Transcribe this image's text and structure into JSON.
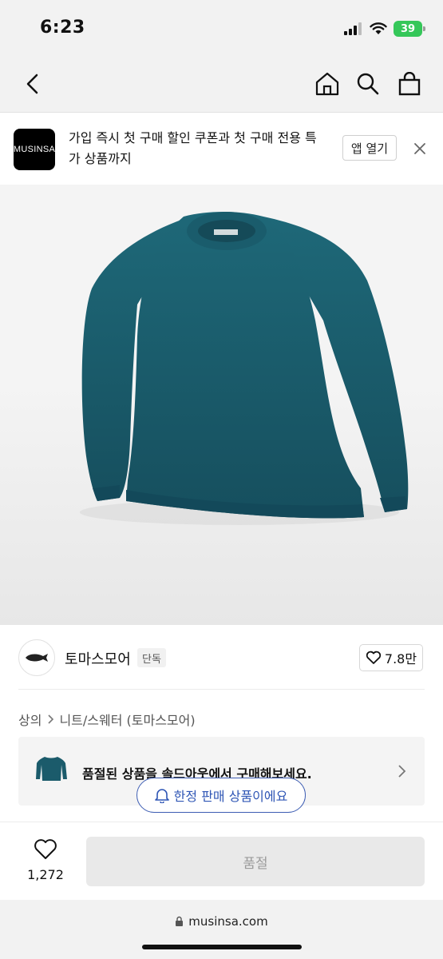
{
  "status": {
    "time": "6:23",
    "battery": "39"
  },
  "nav": {
    "icons": [
      "back-arrow-icon",
      "home-icon",
      "search-icon",
      "shopping-bag-icon"
    ]
  },
  "banner": {
    "logo_text": "MUSINSA",
    "text": "가입 즉시 첫 구매 할인 쿠폰과 첫 구매 전용 특가 상품까지",
    "open_label": "앱 열기"
  },
  "brand": {
    "name": "토마스모어",
    "badge": "단독",
    "likes": "7.8만"
  },
  "breadcrumb": {
    "items": [
      "상의",
      "니트/스웨터 (토마스모어)"
    ]
  },
  "soldout": {
    "message": "품절된 상품을 솔드아웃에서 구매해보세요."
  },
  "limited": {
    "label": "한정 판매 상품이에요"
  },
  "bottom": {
    "wish_count": "1,272",
    "button_label": "품절"
  },
  "url": {
    "domain": "musinsa.com"
  },
  "colors": {
    "product": "#1b5b6b",
    "accent": "#2f56b5",
    "battery": "#35c759"
  }
}
